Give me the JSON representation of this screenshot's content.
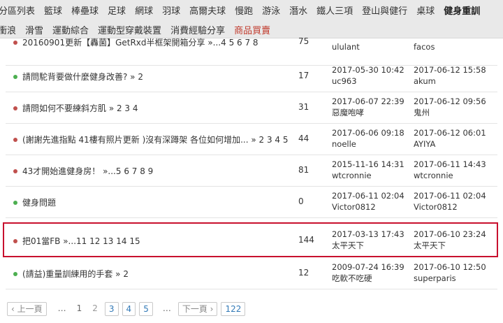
{
  "nav": {
    "row1": [
      "分區列表",
      "籃球",
      "棒壘球",
      "足球",
      "網球",
      "羽球",
      "高爾夫球",
      "慢跑",
      "游泳",
      "潛水",
      "鐵人三項",
      "登山與健行",
      "桌球",
      "健身重訓"
    ],
    "row2": [
      "衝浪",
      "滑雪",
      "運動綜合",
      "運動型穿戴裝置",
      "消費經驗分享",
      "商品買賣"
    ]
  },
  "threads": [
    {
      "title": "20160901更新【轟菌】GetRxd半框架開箱分享 »...4 5 6 7 8",
      "replies": "75",
      "created": "",
      "created_by": "ululant",
      "last": "",
      "last_by": "facos",
      "dot": "red"
    },
    {
      "title": "請問駝背要做什麼健身改善? » 2",
      "replies": "17",
      "created": "2017-05-30 10:42",
      "created_by": "uc963",
      "last": "2017-06-12 15:58",
      "last_by": "akum",
      "dot": "green"
    },
    {
      "title": "請問如何不要練斜方肌 » 2 3 4",
      "replies": "31",
      "created": "2017-06-07 22:39",
      "created_by": "惡魔咆哮",
      "last": "2017-06-12 09:56",
      "last_by": "鬼州",
      "dot": "red"
    },
    {
      "title": "(謝謝先進指點 41樓有照片更新 )沒有深蹲架 各位如何增加... » 2 3 4 5",
      "replies": "44",
      "created": "2017-06-06 09:18",
      "created_by": "noelle",
      "last": "2017-06-12 06:01",
      "last_by": "AYIYA",
      "dot": "red"
    },
    {
      "title": "43才開始進健身房！ »...5 6 7 8 9",
      "replies": "81",
      "created": "2015-11-16 14:31",
      "created_by": "wtcronnie",
      "last": "2017-06-11 14:43",
      "last_by": "wtcronnie",
      "dot": "red"
    },
    {
      "title": "健身問題",
      "replies": "0",
      "created": "2017-06-11 02:04",
      "created_by": "Victor0812",
      "last": "2017-06-11 02:04",
      "last_by": "Victor0812",
      "dot": "green"
    },
    {
      "title": "把01當FB »...11 12 13 14 15",
      "replies": "144",
      "created": "2017-03-13 17:43",
      "created_by": "太平天下",
      "last": "2017-06-10 23:24",
      "last_by": "太平天下",
      "dot": "red"
    },
    {
      "title": "(請益)重量訓練用的手套 » 2",
      "replies": "12",
      "created": "2009-07-24 16:39",
      "created_by": "吃軟不吃硬",
      "last": "2017-06-10 12:50",
      "last_by": "superparis",
      "dot": "green"
    }
  ],
  "pager": {
    "prev": "‹ 上一頁",
    "ellipsis": "…",
    "pages": [
      "1",
      "2",
      "3",
      "4",
      "5"
    ],
    "next": "下一頁 ›",
    "last": "122"
  },
  "colors": {
    "highlight": "#c8102e",
    "dot_red": "#c0504d",
    "dot_green": "#4caf50"
  }
}
